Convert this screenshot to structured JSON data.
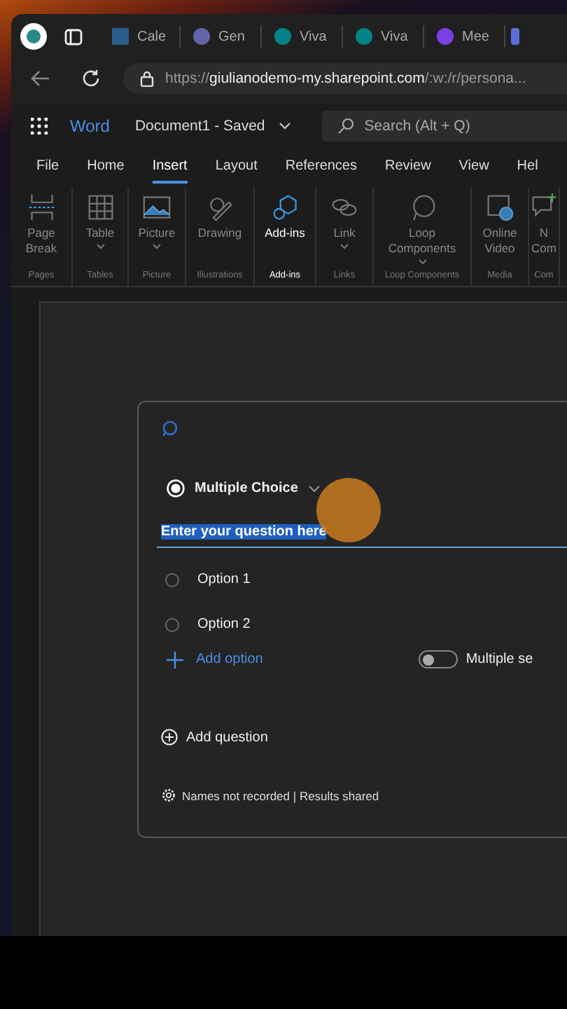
{
  "browser": {
    "tabs": [
      {
        "title": "Cale",
        "selected": false
      },
      {
        "title": "Gen",
        "selected": false
      },
      {
        "title": "Viva",
        "selected": false
      },
      {
        "title": "Viva",
        "selected": false
      },
      {
        "title": "Mee",
        "selected": false
      }
    ],
    "address": {
      "prefix": "https://",
      "host": "giulianodemo-my.sharepoint.com",
      "path": "/:w:/r/persona..."
    }
  },
  "app": {
    "name": "Word",
    "document": "Document1 - Saved",
    "search": {
      "placeholder": "Search (Alt + Q)"
    }
  },
  "ribbon_tabs": [
    {
      "label": "File",
      "selected": false
    },
    {
      "label": "Home",
      "selected": false
    },
    {
      "label": "Insert",
      "selected": true
    },
    {
      "label": "Layout",
      "selected": false
    },
    {
      "label": "References",
      "selected": false
    },
    {
      "label": "Review",
      "selected": false
    },
    {
      "label": "View",
      "selected": false
    },
    {
      "label": "Hel",
      "selected": false
    }
  ],
  "ribbon_groups": [
    {
      "group": "Pages",
      "items": [
        {
          "label": "Page Break",
          "dropdown": false,
          "disabled": true
        }
      ]
    },
    {
      "group": "Tables",
      "items": [
        {
          "label": "Table",
          "dropdown": true,
          "disabled": true
        }
      ]
    },
    {
      "group": "Picture",
      "items": [
        {
          "label": "Picture",
          "dropdown": true,
          "disabled": true
        }
      ]
    },
    {
      "group": "Illustrations",
      "items": [
        {
          "label": "Drawing",
          "dropdown": false,
          "disabled": true
        }
      ]
    },
    {
      "group": "Add-ins",
      "items": [
        {
          "label": "Add-ins",
          "dropdown": false,
          "disabled": false
        }
      ]
    },
    {
      "group": "Links",
      "items": [
        {
          "label": "Link",
          "dropdown": true,
          "disabled": true
        }
      ]
    },
    {
      "group": "Loop Components",
      "items": [
        {
          "label": "Loop Components",
          "dropdown": true,
          "disabled": true
        }
      ]
    },
    {
      "group": "Media",
      "items": [
        {
          "label": "Online Video",
          "dropdown": false,
          "disabled": true
        }
      ]
    },
    {
      "group": "Com",
      "items": [
        {
          "label": "N Com",
          "dropdown": false,
          "disabled": true
        }
      ]
    }
  ],
  "poll": {
    "question_type": "Multiple Choice",
    "question": {
      "value": "Enter your question here",
      "selected": true
    },
    "options": [
      {
        "label": "Option 1",
        "selected": false
      },
      {
        "label": "Option 2",
        "selected": false
      }
    ],
    "add_option": "Add option",
    "multiple_select": {
      "label": "Multiple se",
      "on": false
    },
    "add_question": "Add question",
    "footer": "Names not recorded | Results shared"
  }
}
